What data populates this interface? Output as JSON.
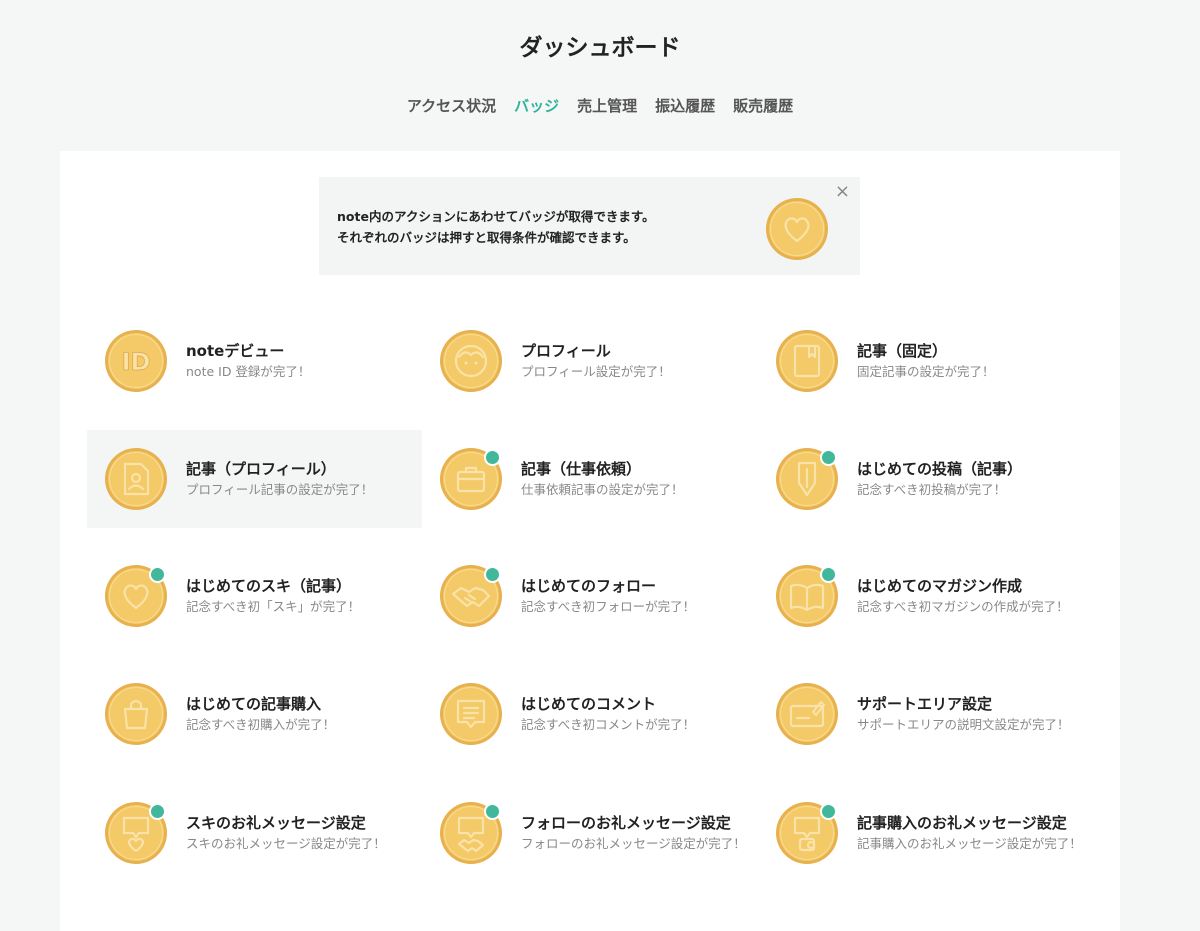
{
  "page": {
    "title": "ダッシュボード"
  },
  "tabs": [
    {
      "label": "アクセス状況",
      "active": false
    },
    {
      "label": "バッジ",
      "active": true
    },
    {
      "label": "売上管理",
      "active": false
    },
    {
      "label": "振込履歴",
      "active": false
    },
    {
      "label": "販売履歴",
      "active": false
    }
  ],
  "notice": {
    "line1": "note内のアクションにあわせてバッジが取得できます。",
    "line2": "それぞれのバッジは押すと取得条件が確認できます。",
    "close_label": "×",
    "icon": "heart-coin-icon"
  },
  "colors": {
    "accent": "#2fb39b",
    "coin": "#f3c96a",
    "coin_rim": "#e9b651",
    "new_dot": "#41b89b"
  },
  "badges": [
    {
      "name": "noteデビュー",
      "desc": "note ID 登録が完了！",
      "icon": "id-icon",
      "new": false
    },
    {
      "name": "プロフィール",
      "desc": "プロフィール設定が完了！",
      "icon": "face-icon",
      "new": false
    },
    {
      "name": "記事（固定）",
      "desc": "固定記事の設定が完了！",
      "icon": "bookmark-icon",
      "new": false
    },
    {
      "name": "記事（プロフィール）",
      "desc": "プロフィール記事の設定が完了！",
      "icon": "profile-card-icon",
      "new": false
    },
    {
      "name": "記事（仕事依頼）",
      "desc": "仕事依頼記事の設定が完了！",
      "icon": "briefcase-icon",
      "new": true
    },
    {
      "name": "はじめての投稿（記事）",
      "desc": "記念すべき初投稿が完了！",
      "icon": "pen-icon",
      "new": true
    },
    {
      "name": "はじめてのスキ（記事）",
      "desc": "記念すべき初「スキ」が完了！",
      "icon": "heart-icon",
      "new": true
    },
    {
      "name": "はじめてのフォロー",
      "desc": "記念すべき初フォローが完了！",
      "icon": "handshake-icon",
      "new": true
    },
    {
      "name": "はじめてのマガジン作成",
      "desc": "記念すべき初マガジンの作成が完了！",
      "icon": "open-book-icon",
      "new": true
    },
    {
      "name": "はじめての記事購入",
      "desc": "記念すべき初購入が完了！",
      "icon": "shopping-bag-icon",
      "new": false
    },
    {
      "name": "はじめてのコメント",
      "desc": "記念すべき初コメントが完了！",
      "icon": "comment-icon",
      "new": false
    },
    {
      "name": "サポートエリア設定",
      "desc": "サポートエリアの説明文設定が完了！",
      "icon": "edit-panel-icon",
      "new": false
    },
    {
      "name": "スキのお礼メッセージ設定",
      "desc": "スキのお礼メッセージ設定が完了！",
      "icon": "message-heart-icon",
      "new": true
    },
    {
      "name": "フォローのお礼メッセージ設定",
      "desc": "フォローのお礼メッセージ設定が完了！",
      "icon": "message-handshake-icon",
      "new": true
    },
    {
      "name": "記事購入のお礼メッセージ設定",
      "desc": "記事購入のお礼メッセージ設定が完了！",
      "icon": "message-coin-icon",
      "new": true
    }
  ]
}
